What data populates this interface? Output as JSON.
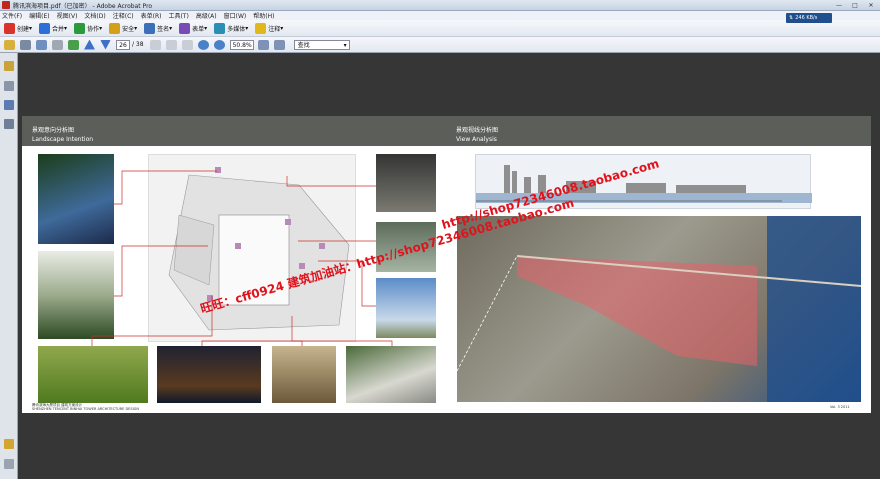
{
  "window": {
    "title": "腾讯滨海项目.pdf（已加密） - Adobe Acrobat Pro",
    "net_speed": "246 KB/s"
  },
  "menu": [
    "文件(F)",
    "编辑(E)",
    "视图(V)",
    "文档(D)",
    "注释(C)",
    "表单(R)",
    "工具(T)",
    "高级(A)",
    "窗口(W)",
    "帮助(H)"
  ],
  "toolbar": [
    {
      "label": "创建",
      "icon": "create-icon",
      "color": "#d9342b"
    },
    {
      "label": "合并",
      "icon": "combine-icon",
      "color": "#2b6fd9"
    },
    {
      "label": "协作",
      "icon": "collaborate-icon",
      "color": "#2b9a3d"
    },
    {
      "label": "安全",
      "icon": "lock-icon",
      "color": "#d4a017"
    },
    {
      "label": "签名",
      "icon": "sign-icon",
      "color": "#3b6fb8"
    },
    {
      "label": "表单",
      "icon": "form-icon",
      "color": "#7a4bb5"
    },
    {
      "label": "多媒体",
      "icon": "multimedia-icon",
      "color": "#2a8fb3"
    },
    {
      "label": "注释",
      "icon": "comment-icon",
      "color": "#e0b81b"
    }
  ],
  "nav": {
    "page": "26",
    "total": "/ 38",
    "zoom": "50.8%",
    "find_placeholder": "查找"
  },
  "page_content": {
    "left_title_cn": "景观意向分析图",
    "left_title_en": "Landscape  Intention",
    "right_title_cn": "景观视线分析图",
    "right_title_en": "View Analysis",
    "footer_cn": "腾讯滨海大厦项目  建筑方案设计",
    "footer_en": "SHENZHEN TENCENT BINHAI TOWER ARCHITECTURE DESIGN",
    "page_number": "Vol. 3 2011"
  },
  "watermark": {
    "line1": "http://shop72346008.taobao.com",
    "line2": "旺旺：cff0924  建筑加油站：http://shop72346008.taobao.com"
  },
  "colors": {
    "accent": "#e0131d",
    "header_band": "#5b5e59",
    "toolbar_bg": "#e3e8f0"
  }
}
